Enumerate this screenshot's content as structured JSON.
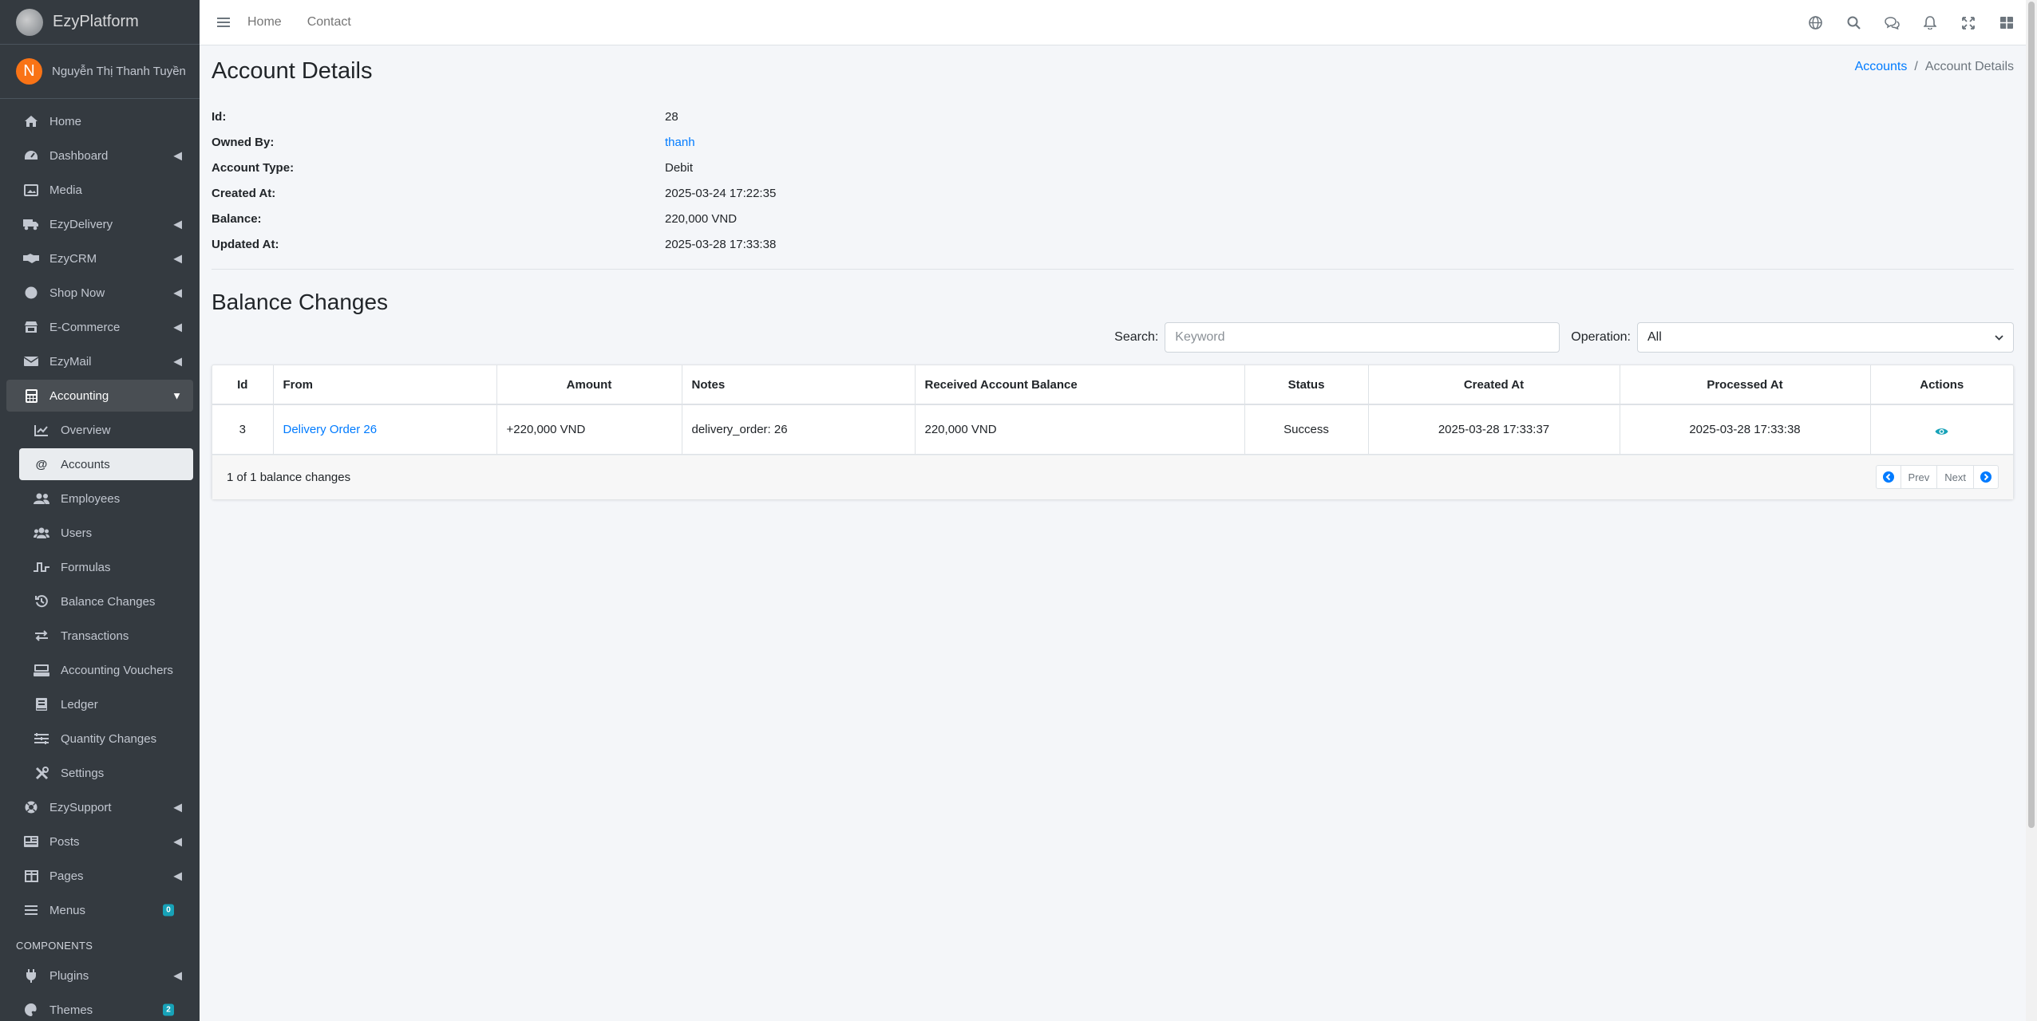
{
  "brand": {
    "name": "EzyPlatform"
  },
  "user": {
    "initial": "N",
    "name": "Nguyễn Thị Thanh Tuyền"
  },
  "sidebar": {
    "items": [
      {
        "label": "Home",
        "icon": "home-icon"
      },
      {
        "label": "Dashboard",
        "icon": "dashboard-icon"
      },
      {
        "label": "Media",
        "icon": "image-icon"
      },
      {
        "label": "EzyDelivery",
        "icon": "truck-icon"
      },
      {
        "label": "EzyCRM",
        "icon": "handshake-icon"
      },
      {
        "label": "Shop Now",
        "icon": "circle-icon"
      },
      {
        "label": "E-Commerce",
        "icon": "store-icon"
      },
      {
        "label": "EzyMail",
        "icon": "envelope-icon"
      },
      {
        "label": "Accounting",
        "icon": "calculator-icon"
      }
    ],
    "accounting_sub": [
      {
        "label": "Overview",
        "icon": "chart-line-icon"
      },
      {
        "label": "Accounts",
        "icon": "at-icon"
      },
      {
        "label": "Employees",
        "icon": "user-group-icon"
      },
      {
        "label": "Users",
        "icon": "users-icon"
      },
      {
        "label": "Formulas",
        "icon": "wave-square-icon"
      },
      {
        "label": "Balance Changes",
        "icon": "history-icon"
      },
      {
        "label": "Transactions",
        "icon": "exchange-icon"
      },
      {
        "label": "Accounting Vouchers",
        "icon": "cash-register-icon"
      },
      {
        "label": "Ledger",
        "icon": "book-icon"
      },
      {
        "label": "Quantity Changes",
        "icon": "layer-icon"
      },
      {
        "label": "Settings",
        "icon": "tools-icon"
      }
    ],
    "after_items": [
      {
        "label": "EzySupport",
        "icon": "life-ring-icon"
      },
      {
        "label": "Posts",
        "icon": "newspaper-icon"
      },
      {
        "label": "Pages",
        "icon": "columns-icon"
      },
      {
        "label": "Menus",
        "icon": "bars-icon",
        "badge": "0"
      }
    ],
    "components_header": "COMPONENTS",
    "component_items": [
      {
        "label": "Plugins",
        "icon": "plug-icon"
      },
      {
        "label": "Themes",
        "icon": "palette-icon",
        "badge": "2"
      }
    ]
  },
  "topbar": {
    "links": [
      "Home",
      "Contact"
    ]
  },
  "page": {
    "title": "Account Details",
    "breadcrumb": {
      "parent": "Accounts",
      "current": "Account Details"
    }
  },
  "details": [
    {
      "label": "Id:",
      "value": "28"
    },
    {
      "label": "Owned By:",
      "value": "thanh",
      "link": true
    },
    {
      "label": "Account Type:",
      "value": "Debit"
    },
    {
      "label": "Created At:",
      "value": "2025-03-24 17:22:35"
    },
    {
      "label": "Balance:",
      "value": "220,000 VND"
    },
    {
      "label": "Updated At:",
      "value": "2025-03-28 17:33:38"
    }
  ],
  "balance_changes": {
    "title": "Balance Changes",
    "search_label": "Search:",
    "search_placeholder": "Keyword",
    "operation_label": "Operation:",
    "operation_value": "All",
    "columns": [
      "Id",
      "From",
      "Amount",
      "Notes",
      "Received Account Balance",
      "Status",
      "Created At",
      "Processed At",
      "Actions"
    ],
    "rows": [
      {
        "id": "3",
        "from": "Delivery Order 26",
        "amount": "+220,000 VND",
        "notes": "delivery_order: 26",
        "received_balance": "220,000 VND",
        "status": "Success",
        "created_at": "2025-03-28 17:33:37",
        "processed_at": "2025-03-28 17:33:38"
      }
    ],
    "footer": "1 of 1 balance changes",
    "prev_label": "Prev",
    "next_label": "Next"
  },
  "colors": {
    "sidebar_bg": "#343a40",
    "link": "#007bff",
    "accent_info": "#17a2b8",
    "avatar": "#f97316"
  }
}
